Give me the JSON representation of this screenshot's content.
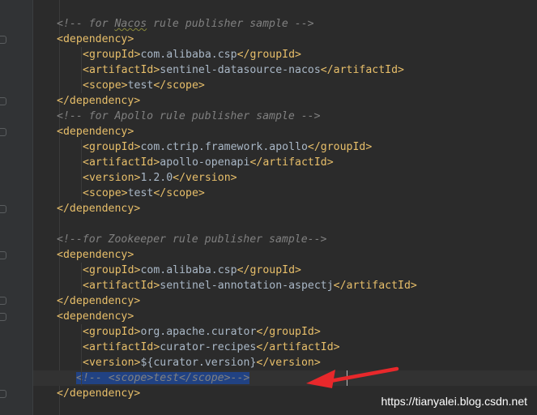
{
  "editor": {
    "language": "xml",
    "lines": [
      {
        "type": "comment",
        "text": "<!-- for Nacos rule publisher sample -->",
        "indent": 0
      },
      {
        "type": "tag",
        "text": "<dependency>",
        "indent": 0
      },
      {
        "type": "element",
        "tag": "groupId",
        "value": "com.alibaba.csp",
        "indent": 1
      },
      {
        "type": "element",
        "tag": "artifactId",
        "value": "sentinel-datasource-nacos",
        "indent": 1
      },
      {
        "type": "element",
        "tag": "scope",
        "value": "test",
        "indent": 1
      },
      {
        "type": "tag",
        "text": "</dependency>",
        "indent": 0
      },
      {
        "type": "comment",
        "text": "<!-- for Apollo rule publisher sample -->",
        "indent": 0
      },
      {
        "type": "tag",
        "text": "<dependency>",
        "indent": 0
      },
      {
        "type": "element",
        "tag": "groupId",
        "value": "com.ctrip.framework.apollo",
        "indent": 1
      },
      {
        "type": "element",
        "tag": "artifactId",
        "value": "apollo-openapi",
        "indent": 1
      },
      {
        "type": "element",
        "tag": "version",
        "value": "1.2.0",
        "indent": 1
      },
      {
        "type": "element",
        "tag": "scope",
        "value": "test",
        "indent": 1
      },
      {
        "type": "tag",
        "text": "</dependency>",
        "indent": 0
      },
      {
        "type": "blank",
        "text": "",
        "indent": 0
      },
      {
        "type": "comment",
        "text": "<!--for Zookeeper rule publisher sample-->",
        "indent": 0
      },
      {
        "type": "tag",
        "text": "<dependency>",
        "indent": 0
      },
      {
        "type": "element",
        "tag": "groupId",
        "value": "com.alibaba.csp",
        "indent": 1
      },
      {
        "type": "element",
        "tag": "artifactId",
        "value": "sentinel-annotation-aspectj",
        "indent": 1
      },
      {
        "type": "tag",
        "text": "</dependency>",
        "indent": 0
      },
      {
        "type": "tag",
        "text": "<dependency>",
        "indent": 0
      },
      {
        "type": "element",
        "tag": "groupId",
        "value": "org.apache.curator",
        "indent": 1
      },
      {
        "type": "element",
        "tag": "artifactId",
        "value": "curator-recipes",
        "indent": 1
      },
      {
        "type": "element",
        "tag": "version",
        "value": "${curator.version}",
        "indent": 1
      },
      {
        "type": "selected-comment",
        "text": "<!-- <scope>test</scope>-->",
        "indent": 1
      },
      {
        "type": "tag",
        "text": "</dependency>",
        "indent": 0
      }
    ],
    "current_line_index": 23
  },
  "watermark": "https://tianyalei.blog.csdn.net",
  "colors": {
    "background": "#2b2b2b",
    "tag": "#e8bf6a",
    "text": "#a9b7c6",
    "comment": "#808080",
    "selection": "#214283",
    "arrow": "#e8282b"
  },
  "icons": {
    "annotation_arrow": "red-arrow-icon"
  }
}
